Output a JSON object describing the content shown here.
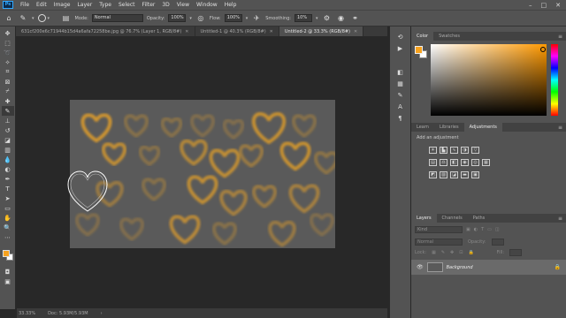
{
  "menubar": {
    "logo": "Ps",
    "items": [
      "File",
      "Edit",
      "Image",
      "Layer",
      "Type",
      "Select",
      "Filter",
      "3D",
      "View",
      "Window",
      "Help"
    ],
    "win_controls": [
      "–",
      "□",
      "✕"
    ]
  },
  "options": {
    "mode_label": "Mode:",
    "mode_value": "Normal",
    "opacity_label": "Opacity:",
    "opacity_value": "100%",
    "flow_label": "Flow:",
    "flow_value": "100%",
    "smoothing_label": "Smoothing:",
    "smoothing_value": "10%"
  },
  "tabs": [
    {
      "label": "631cf200e6c71944b15d4a6afa72258be.jpg @ 76.7% (Layer 1, RGB/8#)",
      "active": false
    },
    {
      "label": "Untitled-1 @ 40.3% (RGB/8#)",
      "active": false
    },
    {
      "label": "Untitled-2 @ 33.3% (RGB/8#)",
      "active": true
    }
  ],
  "status": {
    "zoom": "33.33%",
    "doc": "Doc: 5.93M/5.93M"
  },
  "color_panel": {
    "tabs": [
      "Color",
      "Swatches"
    ],
    "foreground": "#f7a21e",
    "background": "#ffffff"
  },
  "adjustments_panel": {
    "tabs": [
      "Learn",
      "Libraries",
      "Adjustments"
    ],
    "title": "Add an adjustment"
  },
  "layers_panel": {
    "tabs": [
      "Layers",
      "Channels",
      "Paths"
    ],
    "search_placeholder": "Kind",
    "blend_mode": "Normal",
    "opacity_label": "Opacity:",
    "lock_label": "Lock:",
    "fill_label": "Fill:",
    "layers": [
      {
        "name": "Background"
      }
    ]
  },
  "colors": {
    "accent": "#f7a21e",
    "canvas_bg": "#282828",
    "document_bg": "#5a5a5a"
  }
}
